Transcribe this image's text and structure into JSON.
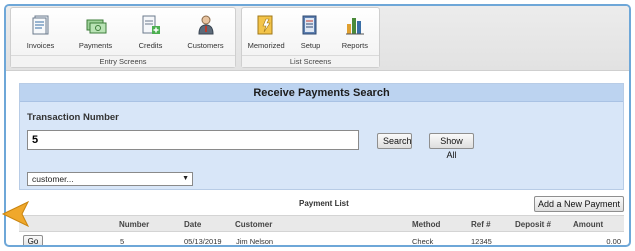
{
  "toolbar": {
    "entry_group": {
      "label": "Entry Screens",
      "buttons": [
        {
          "label": "Invoices",
          "icon": "invoice-icon"
        },
        {
          "label": "Payments",
          "icon": "payment-icon"
        },
        {
          "label": "Credits",
          "icon": "credit-icon"
        },
        {
          "label": "Customers",
          "icon": "customer-icon"
        }
      ]
    },
    "list_group": {
      "label": "List Screens",
      "buttons": [
        {
          "label": "Memorized",
          "icon": "memorized-icon"
        },
        {
          "label": "Setup",
          "icon": "setup-icon"
        },
        {
          "label": "Reports",
          "icon": "reports-icon"
        }
      ]
    }
  },
  "search_panel": {
    "title": "Receive Payments Search",
    "field_label": "Transaction Number",
    "transaction_value": "5",
    "search_label": "Search",
    "show_all_label": "Show All",
    "customer_select_value": "customer..."
  },
  "payment_list": {
    "title": "Payment List",
    "add_button_label": "Add a New Payment",
    "columns": [
      "Number",
      "Date",
      "Customer",
      "Method",
      "Ref #",
      "Deposit #",
      "Amount"
    ],
    "rows": [
      {
        "go_label": "Go",
        "number": "5",
        "date": "05/13/2019",
        "customer": "Jim Nelson",
        "method": "Check",
        "ref": "12345",
        "deposit": "",
        "amount": "0.00"
      }
    ]
  },
  "colors": {
    "accent_border": "#6ea7d8",
    "panel_bg": "#d8e6f8",
    "panel_header": "#bcd3f0",
    "pointer": "#f0a82b"
  }
}
